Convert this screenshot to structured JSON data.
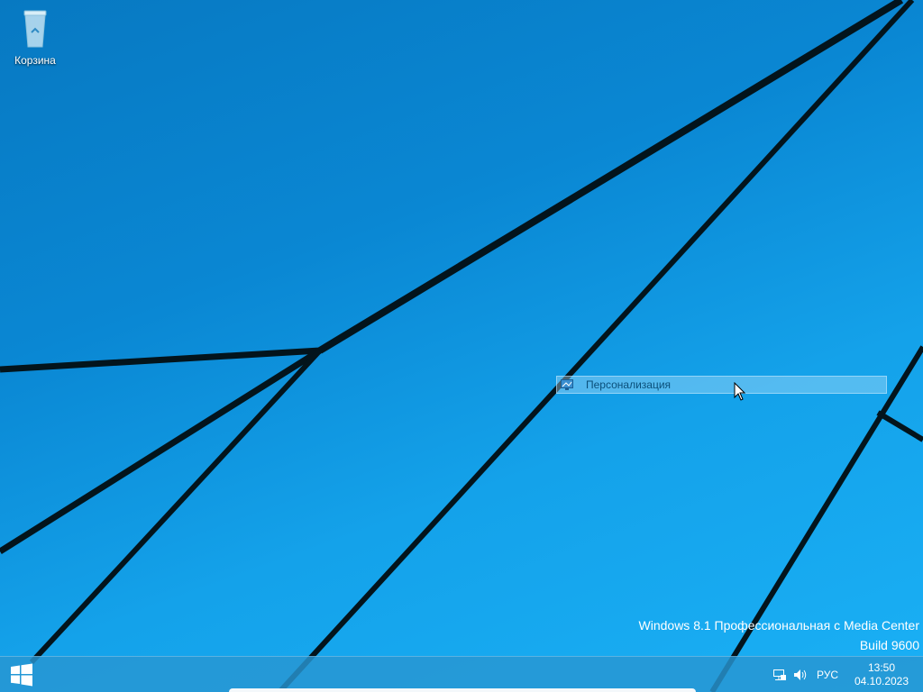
{
  "desktop": {
    "icons": [
      {
        "label": "Корзина",
        "icon": "recycle-bin-icon"
      }
    ]
  },
  "context_menu": {
    "item_label": "Персонализация",
    "item_icon": "personalization-icon"
  },
  "watermark": {
    "edition": "Windows 8.1 Профессиональная с Media Center",
    "build": "Build 9600"
  },
  "taskbar": {
    "start_icon": "windows-logo-icon",
    "tray": {
      "network_icon": "network-icon",
      "volume_icon": "volume-icon",
      "language": "РУС",
      "time": "13:50",
      "date": "04.10.2023"
    }
  },
  "colors": {
    "wallpaper_dark": "#0779c2",
    "wallpaper_light": "#1ab0f5",
    "taskbar": "#2896d2",
    "lines": "#03141c"
  }
}
